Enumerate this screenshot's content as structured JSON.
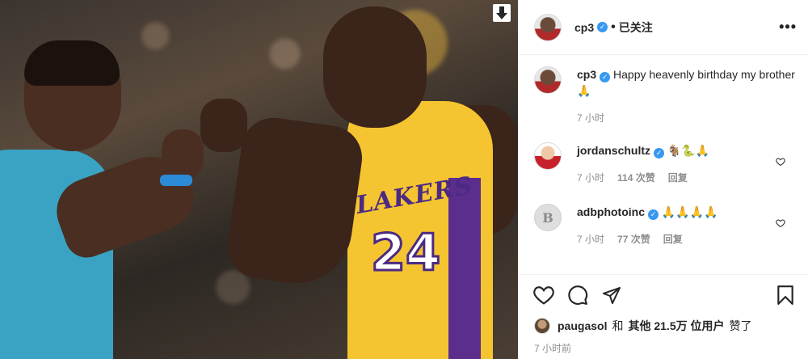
{
  "post": {
    "author": "cp3",
    "follow_separator": "•",
    "follow_status": "已关注",
    "more_label": "•••"
  },
  "photo": {
    "jersey_text": "LAKERS",
    "jersey_number": "24",
    "download_label": "⬇"
  },
  "caption": {
    "username": "cp3",
    "text": "Happy heavenly birthday my brother 🙏",
    "time": "7 小时"
  },
  "comments": [
    {
      "username": "jordanschultz",
      "text": "🐐🐍🙏",
      "time": "7 小时",
      "likes": "114 次赞",
      "reply": "回复"
    },
    {
      "username": "adbphotoinc",
      "text": "🙏🙏🙏🙏",
      "time": "7 小时",
      "likes": "77 次赞",
      "reply": "回复",
      "avatar_letter": "B"
    }
  ],
  "likes_line": {
    "user": "paugasol",
    "conj": "和",
    "others": "其他 21.5万 位用户",
    "suffix": "赞了"
  },
  "posted_time": "7 小时前",
  "colors": {
    "verified": "#3897f0",
    "muted_text": "#8e8e8e",
    "text": "#262626"
  }
}
